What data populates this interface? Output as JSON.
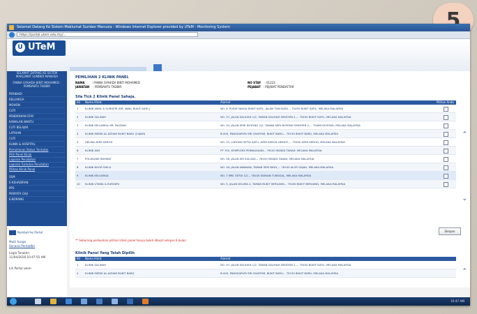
{
  "badge": "5",
  "browser": {
    "title": "Selamat Datang Ke Sistem Maklumat Sumber Manusia - Windows Internet Explorer provided by UTeM - Monitoring System",
    "url": "https://portal.utem.edu.my/..."
  },
  "logo": {
    "mark": "U",
    "text": "UTeM"
  },
  "sidebar": {
    "welcome": "SELAMAT DATANG KE SISTEM MAKLUMAT SUMBER MANUSIA",
    "user": "FANNA SYAHIDA BINTI MOHAMED - PEMBANTU TADBIR",
    "items": [
      "PERIBADI",
      "KELUARGA",
      "MOHON",
      "CUTI",
      "PENDIDIKAN STAF",
      "KAWALAN WAKTU",
      "CUTI BELAJAR",
      "LATIHAN",
      "CUTI",
      "KLINIK & HOSPITAL"
    ],
    "links": [
      "Pemohonan Status Tuntutan",
      "Pilih Panel Klinik",
      "Laporan Perubatan",
      "Laporan Tuntutan Perubatan",
      "Pilihan Klinik Panel"
    ],
    "items2": [
      "SSM",
      "E-KEHADIRAN",
      "PPS",
      "PENYATA GAJI",
      "E-BORANG"
    ],
    "kembali": "Kembali ke Portal",
    "multi_fungsi": "Multi fungsi",
    "senarai": "Senarai Pentadbir",
    "login_label": "Login Terakhir",
    "login_time": "11/04/2016 10:47:55 AM",
    "lain": "Lih Portal utem"
  },
  "main": {
    "heading": "PEMILIHAN 2 KLINIK PANEL",
    "nama_label": "NAMA",
    "nama_value": ": FANNA SYAHIDA BINTI MOHAMED",
    "jawatan_label": "JAWATAN",
    "jawatan_value": ": PEMBANTU TADBIR",
    "nostaf_label": "NO STAF",
    "nostaf_value": ": 01223",
    "pejabat_label": "PEJABAT",
    "pejabat_value": ": PEJABAT PENDAFTAR",
    "section1_title": "Sila Tick 2 Klinik Panel Sahaja.",
    "section2_title": "Klinik Panel Yang Telah Dipilih",
    "columns": [
      "Bil",
      "Nama Klinik",
      "Alamat",
      "Pilihan Anda (Tick)"
    ],
    "clinics": [
      {
        "no": "1",
        "name": "KLINIK AWAL & SURGERI (DR. AWAL BUKIT KATIL)",
        "addr": "NO. 9, PUSAT NIAGA BUKIT KATIL, JALAN TUN KUDU... 75450 BUKIT KATIL, MELAKA MALAYSIA"
      },
      {
        "no": "2",
        "name": "KLINIK SALIHAH",
        "addr": "NO. 37, JALAN SALIHAH 1/2, TAMAN SALIHAH SEKSYEN 2,... 75450 BUKIT KATIL, MELAKA MALAYSIA"
      },
      {
        "no": "3",
        "name": "KLINIK KELUARGA DR. FAUZIAH",
        "addr": "NO. 34, JALAN SERI DUYONG 2/2, TAMAN SERI DUYONG SEKSYEN 2,... 75460 DUYONG, MELAKA MALAYSIA"
      },
      {
        "no": "4",
        "name": "KLINIK MEDIK AL-AZHAR BUKIT BARU (24JAM)",
        "addr": "B-005, PANGSAPURI SRI GHAFFAR, BUKIT BARU... 75150 BUKIT BARU, MELAKA MALAYSIA"
      },
      {
        "no": "5",
        "name": "HELINA AYER KEROH",
        "addr": "NO. 23, LORONG SETIA SATU, AYER KEROH HEIGHT,... 75450 AYER KEROH, MELAKA MALAYSIA"
      },
      {
        "no": "6",
        "name": "KLINIK ASH",
        "addr": "PT 703, KOMPLEKS PERNIAGAAN... 76100 MASJID TANAH, MELAKA MALAYSIA"
      },
      {
        "no": "7",
        "name": "POLIKLINIK RAHMAT",
        "addr": "NO. 28, JALAN IKS SULUNG... 76100 MASJID TANAH, MELAKA MALAYSIA"
      },
      {
        "no": "8",
        "name": "KLINIK NOOR SHILA",
        "addr": "NO. 18, JALAN AWANAN, TAMAN SERI BAYU,... 76100 ALOR GAJAH, MELAKA MALAYSIA"
      },
      {
        "no": "9",
        "name": "KLINIK KELUARGA",
        "addr": "NO. 7 MRC SETIA 1/2... 76100 DURIAN TUNGGAL, MELAKA MALAYSIA"
      },
      {
        "no": "10",
        "name": "KLINIK UTAMA & SURGERI",
        "addr": "NO. 9, JALAN DELIMA 4, TAMAN BUKIT BERUANG... 75450 BUKIT BERUANG, MELAKA MALAYSIA"
      }
    ],
    "simpan": "Simpan",
    "note": "** Sebarang perbuahan pilihan klinik panel hanya boleh dibuat selepas 6 bulan",
    "selected": [
      {
        "no": "1",
        "name": "KLINIK SALIHAH",
        "addr": "NO. 37, JALAN SALIHAH 1/2, TAMAN SALIHAH SEKSYEN 2,... 75450 BUKIT KATIL, MELAKA MALAYSIA"
      },
      {
        "no": "2",
        "name": "KLINIK MEDIK AL-AZHAR BUKIT BARU",
        "addr": "B-005, PANGSAPURI SRI GHAFFAR, BUKIT BARU... 75150 BUKIT BARU, MELAKA MALAYSIA"
      }
    ]
  },
  "taskbar": {
    "clock": "10:47 AM"
  },
  "colors": {
    "primary": "#1f4e94",
    "header_row": "#2b5aa0",
    "warning": "#d0241e",
    "badge": "#f4d2c0"
  }
}
